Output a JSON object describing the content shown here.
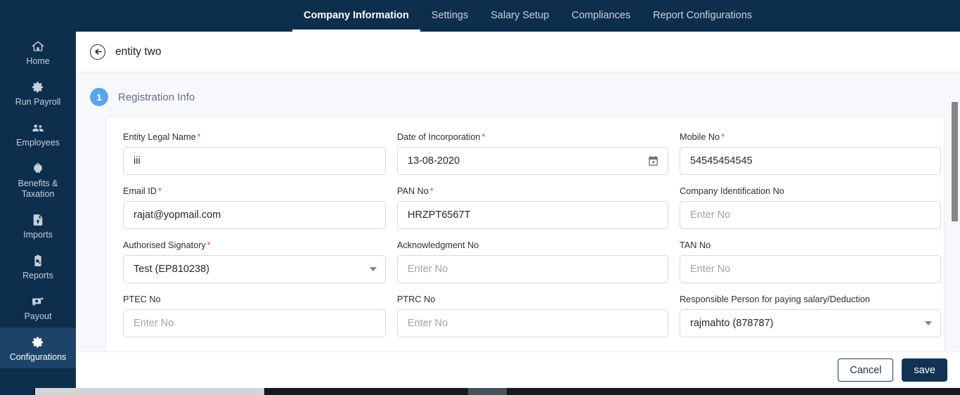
{
  "topnav": {
    "tabs": [
      {
        "label": "Company Information",
        "active": true
      },
      {
        "label": "Settings",
        "active": false
      },
      {
        "label": "Salary Setup",
        "active": false
      },
      {
        "label": "Compliances",
        "active": false
      },
      {
        "label": "Report Configurations",
        "active": false
      }
    ]
  },
  "sidebar": {
    "items": [
      {
        "label": "Home",
        "icon": "home-icon",
        "active": false
      },
      {
        "label": "Run Payroll",
        "icon": "gear-icon",
        "active": false
      },
      {
        "label": "Employees",
        "icon": "people-icon",
        "active": false
      },
      {
        "label": "Benefits & Taxation",
        "icon": "piggybank-icon",
        "active": false
      },
      {
        "label": "Imports",
        "icon": "file-upload-icon",
        "active": false
      },
      {
        "label": "Reports",
        "icon": "clipboard-search-icon",
        "active": false
      },
      {
        "label": "Payout",
        "icon": "money-transfer-icon",
        "active": false
      },
      {
        "label": "Configurations",
        "icon": "gear-icon",
        "active": true
      }
    ]
  },
  "page": {
    "title": "entity two",
    "back_icon": "back-arrow-icon"
  },
  "step": {
    "number": "1",
    "label": "Registration Info"
  },
  "form": {
    "fields": [
      {
        "label": "Entity Legal Name",
        "required": true,
        "type": "text",
        "value": "iii",
        "placeholder": ""
      },
      {
        "label": "Date of Incorporation",
        "required": true,
        "type": "date",
        "value": "13-08-2020",
        "placeholder": "",
        "icon": "calendar-icon"
      },
      {
        "label": "Mobile No",
        "required": true,
        "type": "text",
        "value": "54545454545",
        "placeholder": ""
      },
      {
        "label": "Email ID",
        "required": true,
        "type": "text",
        "value": "rajat@yopmail.com",
        "placeholder": ""
      },
      {
        "label": "PAN No",
        "required": true,
        "type": "text",
        "value": "HRZPT6567T",
        "placeholder": ""
      },
      {
        "label": "Company Identification No",
        "required": false,
        "type": "text",
        "value": "",
        "placeholder": "Enter No"
      },
      {
        "label": "Authorised Signatory",
        "required": true,
        "type": "select",
        "value": "Test (EP810238)",
        "placeholder": "",
        "icon": "chevron-down-icon"
      },
      {
        "label": "Acknowledgment No",
        "required": false,
        "type": "text",
        "value": "",
        "placeholder": "Enter No"
      },
      {
        "label": "TAN No",
        "required": false,
        "type": "text",
        "value": "",
        "placeholder": "Enter No"
      },
      {
        "label": "PTEC No",
        "required": false,
        "type": "text",
        "value": "",
        "placeholder": "Enter No"
      },
      {
        "label": "PTRC No",
        "required": false,
        "type": "text",
        "value": "",
        "placeholder": "Enter No"
      },
      {
        "label": "Responsible Person for paying salary/Deduction",
        "required": false,
        "type": "select",
        "value": "rajmahto (878787)",
        "placeholder": "",
        "icon": "chevron-down-icon"
      }
    ]
  },
  "footer": {
    "cancel_label": "Cancel",
    "save_label": "save"
  },
  "colors": {
    "navy": "#0e2e4e",
    "navy_active": "#1d4368",
    "accent_blue": "#5aa5ea",
    "required_red": "#e8413c",
    "save_button": "#123253",
    "content_bg": "#f6f8fb"
  }
}
